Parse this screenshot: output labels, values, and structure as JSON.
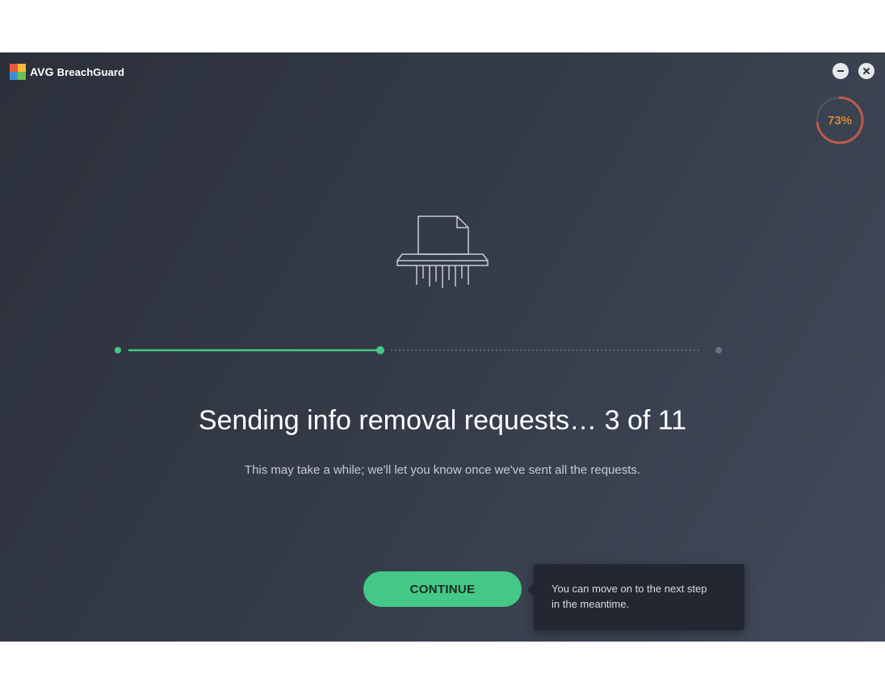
{
  "app": {
    "brand_prefix": "AVG",
    "brand_name": "BreachGuard"
  },
  "window_controls": {
    "minimize_icon": "minus-icon",
    "close_icon": "close-icon"
  },
  "score": {
    "value_text": "73%",
    "value": 73,
    "color": "#d08a3a"
  },
  "progress": {
    "steps": 3,
    "current_step": 2,
    "completed_color": "#43c888",
    "pending_color": "#6b7280"
  },
  "main": {
    "illustration": "paper-shredder-icon",
    "heading": "Sending info removal requests… 3 of 11",
    "subtext": "This may take a while; we'll let you know once we've sent all the requests."
  },
  "actions": {
    "continue_label": "CONTINUE"
  },
  "tooltip": {
    "line1": "You can move on to the next step",
    "line2": "in the meantime."
  },
  "colors": {
    "accent": "#43c888",
    "background": "#343a47",
    "tooltip_bg": "#232731"
  }
}
